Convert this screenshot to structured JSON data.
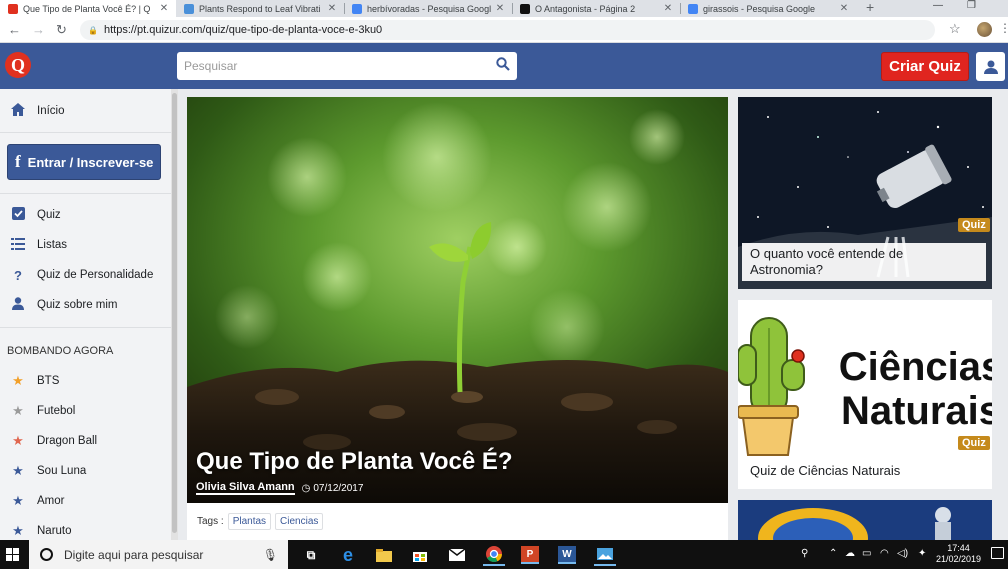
{
  "browser": {
    "tabs": [
      {
        "title": "Que Tipo de Planta Você É? | Q",
        "active": true,
        "favicon": "quizur-icon",
        "color": "#e0311f"
      },
      {
        "title": "Plants Respond to Leaf Vibrati",
        "active": false,
        "favicon": "v-icon",
        "color": "#4a90d9"
      },
      {
        "title": "herbívoradas - Pesquisa Googl",
        "active": false,
        "favicon": "google-icon",
        "color": "#4285f4"
      },
      {
        "title": "O Antagonista - Página 2",
        "active": false,
        "favicon": "antagonista-icon",
        "color": "#111111"
      },
      {
        "title": "girassois - Pesquisa Google",
        "active": false,
        "favicon": "google-icon",
        "color": "#4285f4"
      }
    ],
    "url": "https://pt.quizur.com/quiz/que-tipo-de-planta-voce-e-3ku0"
  },
  "header": {
    "search_placeholder": "Pesquisar",
    "create_quiz_label": "Criar Quiz"
  },
  "sidebar": {
    "home_label": "Início",
    "login_label": "Entrar / Inscrever-se",
    "types": [
      {
        "label": "Quiz",
        "icon": "check-square-icon"
      },
      {
        "label": "Listas",
        "icon": "list-icon"
      },
      {
        "label": "Quiz de Personalidade",
        "icon": "question-icon"
      },
      {
        "label": "Quiz sobre mim",
        "icon": "user-icon"
      }
    ],
    "trending_title": "BOMBANDO AGORA",
    "trending": [
      {
        "label": "BTS",
        "color": "#f2a02a"
      },
      {
        "label": "Futebol",
        "color": "#9a9a9a"
      },
      {
        "label": "Dragon Ball",
        "color": "#e0664f"
      },
      {
        "label": "Sou Luna",
        "color": "#3b5998"
      },
      {
        "label": "Amor",
        "color": "#3b5998"
      },
      {
        "label": "Naruto",
        "color": "#3b5998"
      }
    ]
  },
  "hero": {
    "title": "Que Tipo de Planta Você É?",
    "author": "Olivia Silva Amann",
    "date": "07/12/2017",
    "tags_label": "Tags :",
    "tags": [
      "Plantas",
      "Ciencias"
    ]
  },
  "related": [
    {
      "title": "O quanto você entende de Astronomia?",
      "badge": "Quiz"
    },
    {
      "title": "Quiz de Ciências Naturais",
      "badge": "Quiz",
      "art_text": [
        "Ciências",
        "Naturais"
      ]
    }
  ],
  "taskbar": {
    "search_placeholder": "Digite aqui para pesquisar",
    "time": "17:44",
    "date": "21/02/2019"
  },
  "colors": {
    "brand": "#3b5998",
    "accent": "#e0251f",
    "badge": "#c58a1c"
  }
}
